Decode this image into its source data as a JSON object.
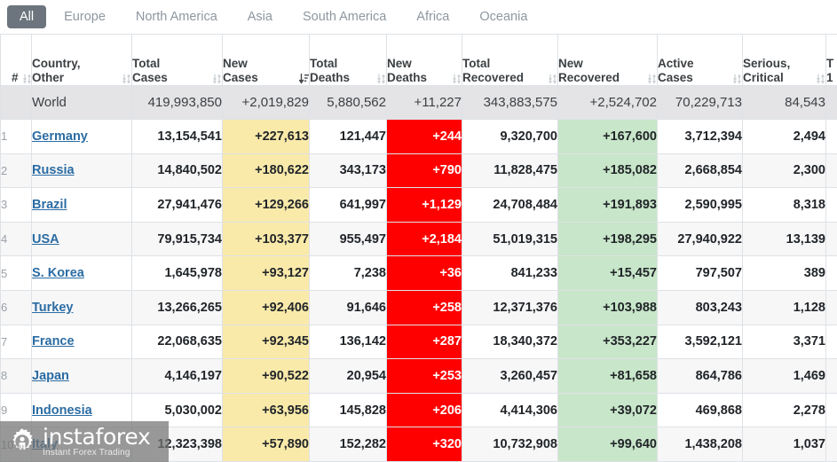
{
  "tabs": [
    {
      "label": "All",
      "active": true
    },
    {
      "label": "Europe",
      "active": false
    },
    {
      "label": "North America",
      "active": false
    },
    {
      "label": "Asia",
      "active": false
    },
    {
      "label": "South America",
      "active": false
    },
    {
      "label": "Africa",
      "active": false
    },
    {
      "label": "Oceania",
      "active": false
    }
  ],
  "table": {
    "columns": [
      {
        "key": "index",
        "line1": "",
        "line2": "#",
        "sort": "both"
      },
      {
        "key": "country",
        "line1": "Country,",
        "line2": "Other",
        "sort": "both"
      },
      {
        "key": "total_cases",
        "line1": "Total",
        "line2": "Cases",
        "sort": "both"
      },
      {
        "key": "new_cases",
        "line1": "New",
        "line2": "Cases",
        "sort": "desc"
      },
      {
        "key": "total_deaths",
        "line1": "Total",
        "line2": "Deaths",
        "sort": "both"
      },
      {
        "key": "new_deaths",
        "line1": "New",
        "line2": "Deaths",
        "sort": "both"
      },
      {
        "key": "total_recovered",
        "line1": "Total",
        "line2": "Recovered",
        "sort": "both"
      },
      {
        "key": "new_recovered",
        "line1": "New",
        "line2": "Recovered",
        "sort": "both"
      },
      {
        "key": "active_cases",
        "line1": "Active",
        "line2": "Cases",
        "sort": "both"
      },
      {
        "key": "serious",
        "line1": "Serious,",
        "line2": "Critical",
        "sort": "both"
      },
      {
        "key": "tot_per_1m",
        "line1": "T",
        "line2": "1",
        "sort": "none"
      }
    ],
    "world_row": {
      "index": "",
      "country": "World",
      "total_cases": "419,993,850",
      "new_cases": "+2,019,829",
      "total_deaths": "5,880,562",
      "new_deaths": "+11,227",
      "total_recovered": "343,883,575",
      "new_recovered": "+2,524,702",
      "active_cases": "70,229,713",
      "serious": "84,543",
      "tot_per_1m": ""
    },
    "rows": [
      {
        "index": "1",
        "country": "Germany",
        "total_cases": "13,154,541",
        "new_cases": "+227,613",
        "total_deaths": "121,447",
        "new_deaths": "+244",
        "total_recovered": "9,320,700",
        "new_recovered": "+167,600",
        "active_cases": "3,712,394",
        "serious": "2,494",
        "tot_per_1m": ""
      },
      {
        "index": "2",
        "country": "Russia",
        "total_cases": "14,840,502",
        "new_cases": "+180,622",
        "total_deaths": "343,173",
        "new_deaths": "+790",
        "total_recovered": "11,828,475",
        "new_recovered": "+185,082",
        "active_cases": "2,668,854",
        "serious": "2,300",
        "tot_per_1m": ""
      },
      {
        "index": "3",
        "country": "Brazil",
        "total_cases": "27,941,476",
        "new_cases": "+129,266",
        "total_deaths": "641,997",
        "new_deaths": "+1,129",
        "total_recovered": "24,708,484",
        "new_recovered": "+191,893",
        "active_cases": "2,590,995",
        "serious": "8,318",
        "tot_per_1m": ""
      },
      {
        "index": "4",
        "country": "USA",
        "total_cases": "79,915,734",
        "new_cases": "+103,377",
        "total_deaths": "955,497",
        "new_deaths": "+2,184",
        "total_recovered": "51,019,315",
        "new_recovered": "+198,295",
        "active_cases": "27,940,922",
        "serious": "13,139",
        "tot_per_1m": ""
      },
      {
        "index": "5",
        "country": "S. Korea",
        "total_cases": "1,645,978",
        "new_cases": "+93,127",
        "total_deaths": "7,238",
        "new_deaths": "+36",
        "total_recovered": "841,233",
        "new_recovered": "+15,457",
        "active_cases": "797,507",
        "serious": "389",
        "tot_per_1m": ""
      },
      {
        "index": "6",
        "country": "Turkey",
        "total_cases": "13,266,265",
        "new_cases": "+92,406",
        "total_deaths": "91,646",
        "new_deaths": "+258",
        "total_recovered": "12,371,376",
        "new_recovered": "+103,988",
        "active_cases": "803,243",
        "serious": "1,128",
        "tot_per_1m": ""
      },
      {
        "index": "7",
        "country": "France",
        "total_cases": "22,068,635",
        "new_cases": "+92,345",
        "total_deaths": "136,142",
        "new_deaths": "+287",
        "total_recovered": "18,340,372",
        "new_recovered": "+353,227",
        "active_cases": "3,592,121",
        "serious": "3,371",
        "tot_per_1m": ""
      },
      {
        "index": "8",
        "country": "Japan",
        "total_cases": "4,146,197",
        "new_cases": "+90,522",
        "total_deaths": "20,954",
        "new_deaths": "+253",
        "total_recovered": "3,260,457",
        "new_recovered": "+81,658",
        "active_cases": "864,786",
        "serious": "1,469",
        "tot_per_1m": ""
      },
      {
        "index": "9",
        "country": "Indonesia",
        "total_cases": "5,030,002",
        "new_cases": "+63,956",
        "total_deaths": "145,828",
        "new_deaths": "+206",
        "total_recovered": "4,414,306",
        "new_recovered": "+39,072",
        "active_cases": "469,868",
        "serious": "2,278",
        "tot_per_1m": ""
      },
      {
        "index": "10",
        "country": "Italy",
        "total_cases": "12,323,398",
        "new_cases": "+57,890",
        "total_deaths": "152,282",
        "new_deaths": "+320",
        "total_recovered": "10,732,908",
        "new_recovered": "+99,640",
        "active_cases": "1,438,208",
        "serious": "1,037",
        "tot_per_1m": ""
      }
    ]
  },
  "watermark": {
    "title": "instaforex",
    "subtitle": "Instant Forex Trading",
    "logo_icon": "instaforex-gear-logo"
  },
  "colors": {
    "new_cases_highlight": "#faeaaa",
    "new_recovered_highlight": "#c8e6c9",
    "new_deaths_highlight": "#ff0000",
    "link": "#2b6ca3",
    "active_tab_bg": "#6c757d",
    "world_row_bg": "#e4e4e6"
  }
}
